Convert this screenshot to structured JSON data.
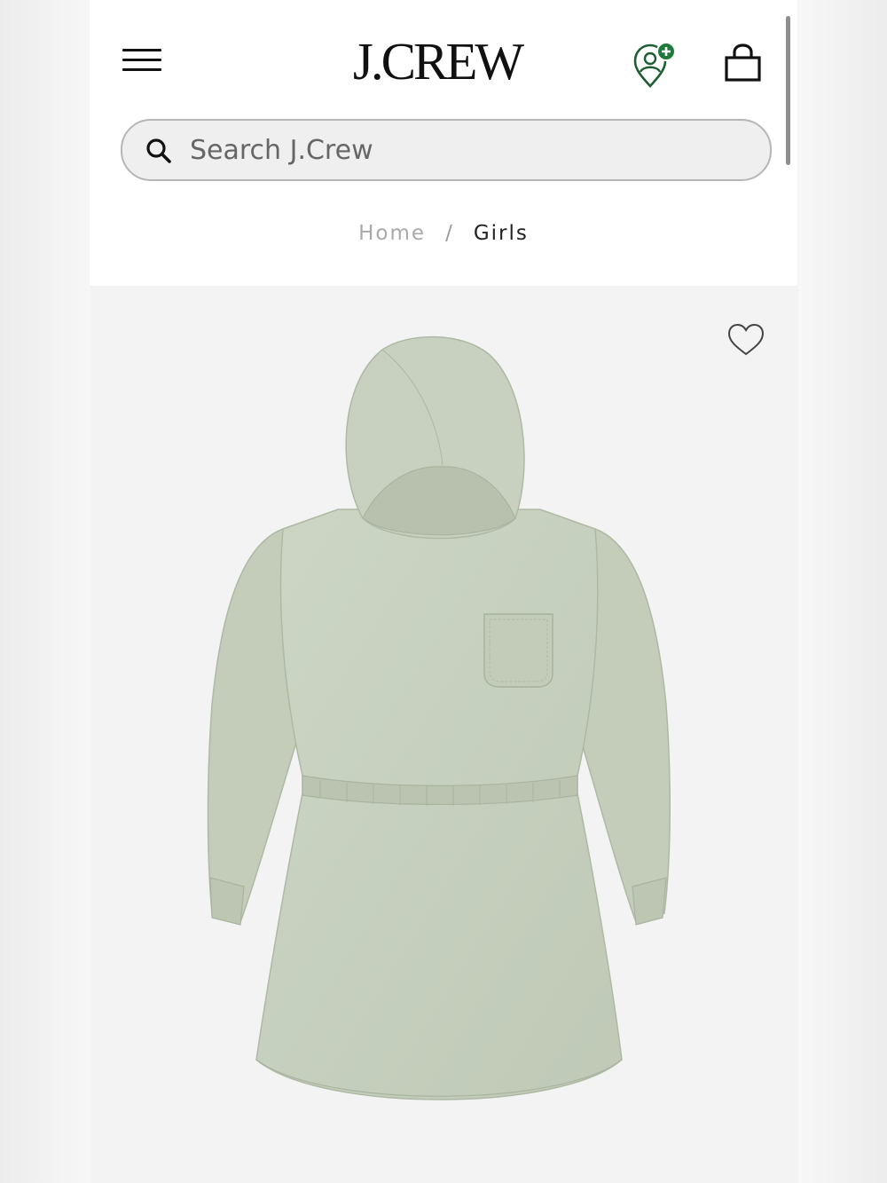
{
  "header": {
    "logo_text": "J.CREW",
    "menu_icon": "hamburger-menu-icon",
    "location_icon": "store-location-icon",
    "bag_icon": "shopping-bag-icon"
  },
  "search": {
    "placeholder": "Search J.Crew",
    "icon": "search-icon"
  },
  "breadcrumb": {
    "home": "Home",
    "separator": "/",
    "current": "Girls"
  },
  "product": {
    "wishlist_icon": "heart-icon",
    "image_name": "girls-hoodie-dress"
  },
  "colors": {
    "brand_green": "#1f7a3a",
    "product_bg": "#f3f3f3",
    "dress_sage": "#c6d0bd"
  }
}
